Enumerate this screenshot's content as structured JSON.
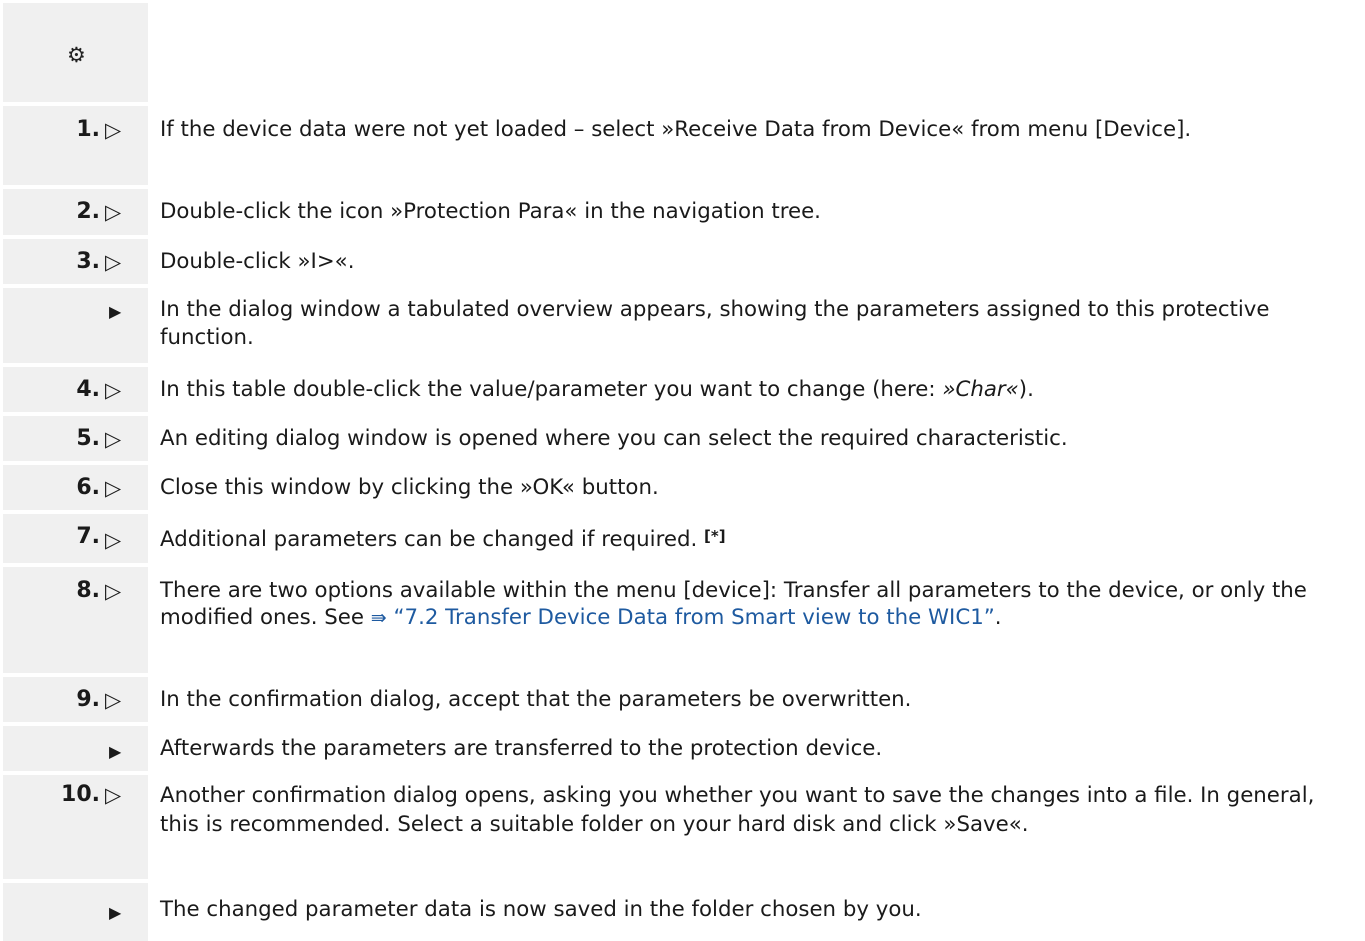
{
  "header": {
    "icon": "gear-icon",
    "icon_glyph": "⚙"
  },
  "steps": [
    {
      "num": "1.",
      "marker": "▷",
      "text": "If the device data were not yet loaded – select »Receive Data from Device« from menu [Device]."
    },
    {
      "num": "2.",
      "marker": "▷",
      "text": "Double-click the icon »Protection Para« in the navigation tree."
    },
    {
      "num": "3.",
      "marker": "▷",
      "text": "Double-click »I>«."
    },
    {
      "num": "",
      "marker": "▶",
      "text": "In the dialog window a tabulated overview appears, showing the parameters assigned to this protective function."
    },
    {
      "num": "4.",
      "marker": "▷",
      "text_before": "In this table double-click the value/parameter you want to change (here: ",
      "text_em": "»Char«",
      "text_after": ")."
    },
    {
      "num": "5.",
      "marker": "▷",
      "text": "An editing dialog window is opened where you can select the required characteristic."
    },
    {
      "num": "6.",
      "marker": "▷",
      "text": "Close this window by clicking the »OK« button."
    },
    {
      "num": "7.",
      "marker": "▷",
      "text": "Additional parameters can be changed if required.",
      "sup": "[*]"
    },
    {
      "num": "8.",
      "marker": "▷",
      "text_before": "There are two options available within the menu [device]: Transfer all parameters to the device, or only the modified ones. See ",
      "link_icon": "⇛",
      "link_text": "“7.2 Transfer Device Data from Smart view to the WIC1”",
      "text_after": "."
    },
    {
      "num": "9.",
      "marker": "▷",
      "text": "In the confirmation dialog, accept that the parameters be overwritten."
    },
    {
      "num": "",
      "marker": "▶",
      "text": "Afterwards the parameters are transferred to the protection device."
    },
    {
      "num": "10.",
      "marker": "▷",
      "text": "Another confirmation dialog opens, asking you whether you want to save the changes into a file. In general, this is recommended. Select a suitable folder on your hard disk and click »Save«."
    },
    {
      "num": "",
      "marker": "▶",
      "text": "The changed parameter data is now saved in the folder chosen by you."
    }
  ],
  "colors": {
    "gutter": "#f0f0f0",
    "link": "#1e5aa0",
    "text": "#1a1a1a"
  }
}
